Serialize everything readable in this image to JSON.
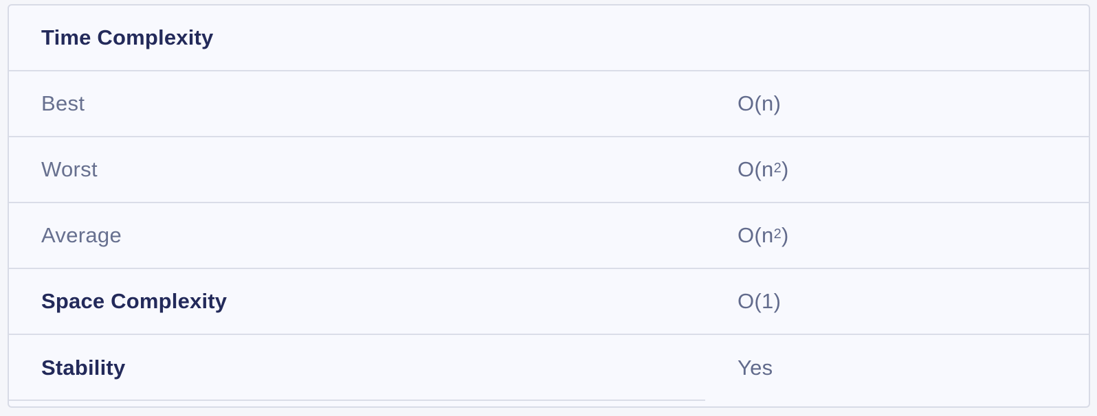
{
  "table": {
    "header": "Time Complexity",
    "rows": [
      {
        "label": "Best",
        "value_base": "O(n",
        "value_exp": "",
        "value_close": ")",
        "bold": false
      },
      {
        "label": "Worst",
        "value_base": "O(n",
        "value_exp": "2",
        "value_close": ")",
        "bold": false
      },
      {
        "label": "Average",
        "value_base": "O(n",
        "value_exp": "2",
        "value_close": ")",
        "bold": false
      },
      {
        "label": "Space Complexity",
        "value_base": "O(1)",
        "value_exp": "",
        "value_close": "",
        "bold": true
      },
      {
        "label": "Stability",
        "value_base": "Yes",
        "value_exp": "",
        "value_close": "",
        "bold": true
      }
    ]
  },
  "colors": {
    "heading": "#232a5a",
    "muted_text": "#67708f",
    "border": "#dadde8",
    "background": "#f8f9fe"
  }
}
